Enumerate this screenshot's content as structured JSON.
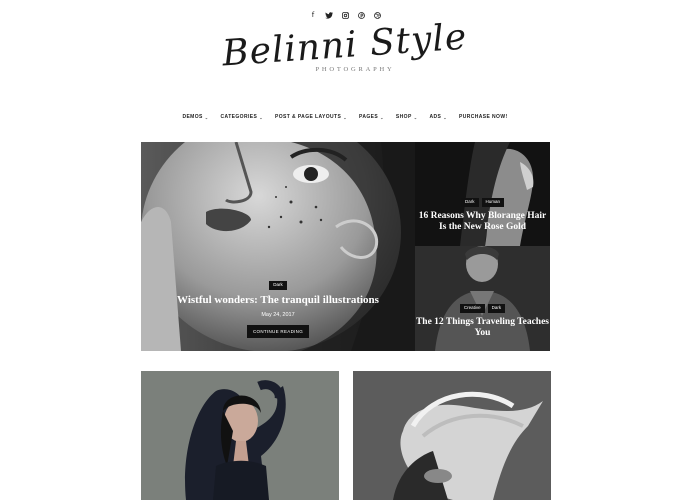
{
  "social_icons": [
    {
      "name": "facebook-icon",
      "glyph": "f"
    },
    {
      "name": "twitter-icon",
      "glyph": "🐦"
    },
    {
      "name": "instagram-icon",
      "glyph": "◻"
    },
    {
      "name": "pinterest-icon",
      "glyph": "℗"
    },
    {
      "name": "dribbble-icon",
      "glyph": "◎"
    }
  ],
  "logo": {
    "script": "Belinni Style",
    "subtitle": "PHOTOGRAPHY"
  },
  "nav": {
    "items": [
      {
        "label": "DEMOS",
        "dropdown": true
      },
      {
        "label": "CATEGORIES",
        "dropdown": true
      },
      {
        "label": "POST & PAGE LAYOUTS",
        "dropdown": true
      },
      {
        "label": "PAGES",
        "dropdown": true
      },
      {
        "label": "SHOP",
        "dropdown": true
      },
      {
        "label": "ADS",
        "dropdown": true
      },
      {
        "label": "PURCHASE NOW!",
        "dropdown": false
      }
    ],
    "chevron": "⌄"
  },
  "featured": {
    "main": {
      "tags": [
        "Dark"
      ],
      "title": "Wistful wonders: The tranquil illustrations",
      "date": "May 24, 2017",
      "button": "CONTINUE READING"
    },
    "side_top": {
      "tags": [
        "Dark",
        "Human"
      ],
      "title": "16 Reasons Why Blorange Hair Is the New Rose Gold"
    },
    "side_bottom": {
      "tags": [
        "Creative",
        "Dark"
      ],
      "title": "The 12 Things Traveling Teaches You"
    }
  },
  "colors": {
    "tag_bg": "#111111",
    "text": "#111111",
    "overlay_text": "#ffffff"
  }
}
